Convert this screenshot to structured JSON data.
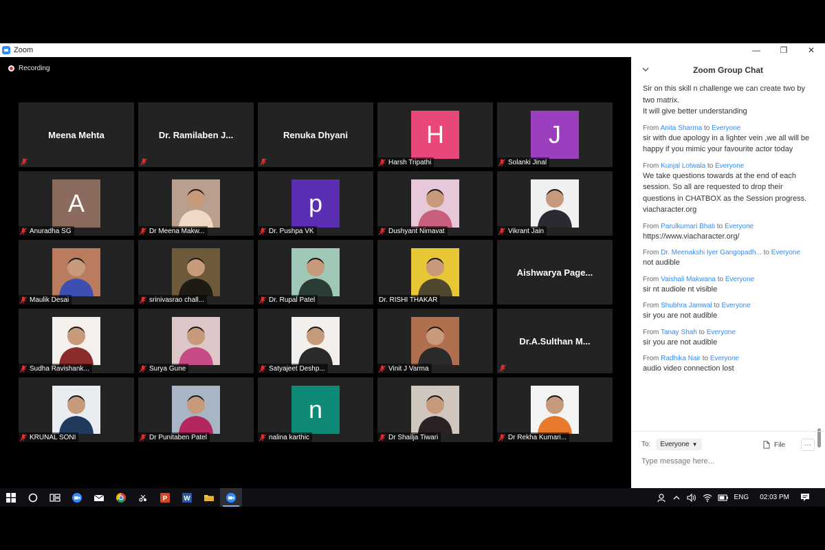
{
  "window": {
    "title": "Zoom",
    "controls": {
      "minimize": "—",
      "maximize": "❐",
      "close": "✕"
    }
  },
  "recording_label": "Recording",
  "participants": [
    {
      "name": "Meena Mehta",
      "display": "name-center"
    },
    {
      "name": "Dr. Ramilaben J...",
      "display": "name-center"
    },
    {
      "name": "Renuka Dhyani",
      "display": "name-center"
    },
    {
      "name": "Harsh Tripathi",
      "display": "letter",
      "letter": "H",
      "color": "#e8477a"
    },
    {
      "name": "Solanki Jinal",
      "display": "letter",
      "letter": "J",
      "color": "#9b3fbf"
    },
    {
      "name": "Anuradha SG",
      "display": "letter",
      "letter": "A",
      "color": "#8a6b5e"
    },
    {
      "name": "Dr Meena Makw...",
      "display": "photo",
      "photo_bg": "#b99f8e",
      "photo_fg": "#efd9c5"
    },
    {
      "name": "Dr. Pushpa VK",
      "display": "letter",
      "letter": "p",
      "color": "#5b2fb3"
    },
    {
      "name": "Dushyant Nimavat",
      "display": "photo",
      "photo_bg": "#e7c8d8",
      "photo_fg": "#c85f7e"
    },
    {
      "name": "Vikrant Jain",
      "display": "photo",
      "photo_bg": "#f0f0f0",
      "photo_fg": "#2a2a33"
    },
    {
      "name": "Maulik Desai",
      "display": "photo",
      "photo_bg": "#b97c5e",
      "photo_fg": "#3d4fb0"
    },
    {
      "name": "srinivasrao chall...",
      "display": "photo",
      "photo_bg": "#6d5a3b",
      "photo_fg": "#1e1a14"
    },
    {
      "name": "Dr. Rupal Patel",
      "display": "photo",
      "photo_bg": "#9fc9b6",
      "photo_fg": "#2b3b35"
    },
    {
      "name": "Dr. RISHI THAKAR",
      "display": "photo",
      "photo_bg": "#e8c737",
      "photo_fg": "#50462e",
      "no_mute": true
    },
    {
      "name": "Aishwarya Page...",
      "display": "name-center",
      "no_label": true
    },
    {
      "name": "Sudha Ravishank...",
      "display": "photo",
      "photo_bg": "#f5f0ec",
      "photo_fg": "#8b2c2c"
    },
    {
      "name": "Surya Gune",
      "display": "photo",
      "photo_bg": "#dcc6c8",
      "photo_fg": "#c64a84"
    },
    {
      "name": "Satyajeet Deshp...",
      "display": "photo",
      "photo_bg": "#f2efed",
      "photo_fg": "#2a2a2a"
    },
    {
      "name": "Vinit J Varma",
      "display": "photo",
      "photo_bg": "#b06f4f",
      "photo_fg": "#2a2a2a"
    },
    {
      "name": "Dr.A.Sulthan M...",
      "display": "name-center",
      "mute_only": true
    },
    {
      "name": "KRUNAL SONI",
      "display": "photo",
      "photo_bg": "#e9ecf1",
      "photo_fg": "#1f3a5c"
    },
    {
      "name": "Dr Punitaben Patel",
      "display": "photo",
      "photo_bg": "#a7b5c4",
      "photo_fg": "#b4265e"
    },
    {
      "name": "nalina karthic",
      "display": "letter",
      "letter": "n",
      "color": "#0e8a76"
    },
    {
      "name": "Dr Shailja Tiwari",
      "display": "photo",
      "photo_bg": "#cfc6bd",
      "photo_fg": "#2a2222"
    },
    {
      "name": "Dr Rekha Kumari...",
      "display": "photo",
      "photo_bg": "#f3f3f3",
      "photo_fg": "#e77a2c"
    }
  ],
  "chat": {
    "title": "Zoom Group Chat",
    "messages": [
      {
        "from": "",
        "to": "",
        "text": "Sir on this skill n challenge we can create two by two matrix.\nIt will give better understanding"
      },
      {
        "from": "Anita Sharma",
        "to": "Everyone",
        "text": "sir with due apology in a lighter vein ,we all will be happy  if you mimic your favourite actor today"
      },
      {
        "from": "Kunjal Lotwala",
        "to": "Everyone",
        "text": "We take questions towards at the end of each session. So all are requested to drop their questions in CHATBOX as the Session progress.\nviacharacter.org"
      },
      {
        "from": "Parulkumari Bhati",
        "to": "Everyone",
        "text": "https://www.viacharacter.org/"
      },
      {
        "from": "Dr. Meenakshi Iyer Gangopadh...",
        "to": "Everyone",
        "text": "not audible"
      },
      {
        "from": "Vaishali Makwana",
        "to": "Everyone",
        "text": "sir nt audiole nt visible"
      },
      {
        "from": "Shubhra Jamwal",
        "to": "Everyone",
        "text": "sir you are not audible"
      },
      {
        "from": "Tanay Shah",
        "to": "Everyone",
        "text": "sir you are not audible"
      },
      {
        "from": "Radhika Nair",
        "to": "Everyone",
        "text": "audio video connection lost"
      }
    ],
    "from_word": "From",
    "to_word": "to",
    "to_label": "To:",
    "recipient": "Everyone",
    "file_label": "File",
    "more_label": "···",
    "input_placeholder": "Type message here..."
  },
  "taskbar": {
    "tray": {
      "language": "ENG",
      "time": "02:03 PM"
    }
  },
  "colors": {
    "tile_bg": "#232323",
    "accent_blue": "#2d8cff",
    "mute_red": "#e02f2f"
  }
}
